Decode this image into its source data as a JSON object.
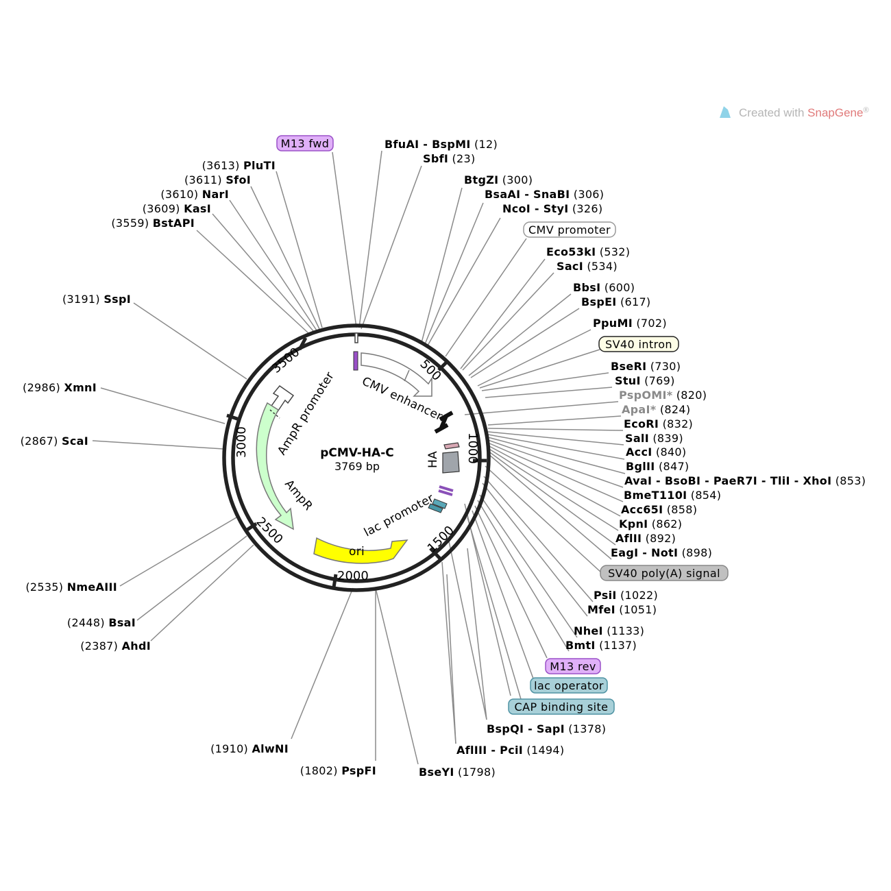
{
  "watermark": {
    "prefix": "Created with ",
    "brand": "SnapGene",
    "suffix": "®",
    "brand_color": "#e05a5a",
    "icon": "snapgene-logo-icon"
  },
  "plasmid": {
    "name": "pCMV-HA-C",
    "length": "3769 bp"
  },
  "ticks": [
    "500",
    "1000",
    "1500",
    "2000",
    "2500",
    "3000",
    "3500"
  ],
  "features": [
    {
      "name": "CMV enhancer",
      "color": "#ffffff"
    },
    {
      "name": "AmpR promoter",
      "color": "#ffffff"
    },
    {
      "name": "AmpR",
      "color": "#ccffcc"
    },
    {
      "name": "ori",
      "color": "#ffff00"
    },
    {
      "name": "lac promoter",
      "color": "#ffffff"
    },
    {
      "name": "HA",
      "color": "#a0a5ab"
    }
  ],
  "labeled_features": [
    {
      "name": "M13 fwd",
      "color": "#e0b0f8"
    },
    {
      "name": "CMV promoter",
      "color": "#ffffff"
    },
    {
      "name": "SV40 intron",
      "color": "#fdfde6"
    },
    {
      "name": "SV40 poly(A) signal",
      "color": "#c0c0c0"
    },
    {
      "name": "M13 rev",
      "color": "#e0b0f8"
    },
    {
      "name": "lac operator",
      "color": "#a8d0d8"
    },
    {
      "name": "CAP binding site",
      "color": "#a8d0d8"
    }
  ],
  "sites_right": [
    {
      "name": "BfuAI - BspMI",
      "pos": "(12)"
    },
    {
      "name": "SbfI",
      "pos": "(23)"
    },
    {
      "name": "BtgZI",
      "pos": "(300)"
    },
    {
      "name": "BsaAI - SnaBI",
      "pos": "(306)"
    },
    {
      "name": "NcoI - StyI",
      "pos": "(326)"
    },
    {
      "name": "Eco53kI",
      "pos": "(532)"
    },
    {
      "name": "SacI",
      "pos": "(534)"
    },
    {
      "name": "BbsI",
      "pos": "(600)"
    },
    {
      "name": "BspEI",
      "pos": "(617)"
    },
    {
      "name": "PpuMI",
      "pos": "(702)"
    },
    {
      "name": "BseRI",
      "pos": "(730)"
    },
    {
      "name": "StuI",
      "pos": "(769)"
    },
    {
      "name": "PspOMI*",
      "pos": "(820)"
    },
    {
      "name": "ApaI*",
      "pos": "(824)"
    },
    {
      "name": "EcoRI",
      "pos": "(832)"
    },
    {
      "name": "SalI",
      "pos": "(839)"
    },
    {
      "name": "AccI",
      "pos": "(840)"
    },
    {
      "name": "BglII",
      "pos": "(847)"
    },
    {
      "name": "AvaI - BsoBI - PaeR7I - TliI - XhoI",
      "pos": "(853)"
    },
    {
      "name": "BmeT110I",
      "pos": "(854)"
    },
    {
      "name": "Acc65I",
      "pos": "(858)"
    },
    {
      "name": "KpnI",
      "pos": "(862)"
    },
    {
      "name": "AflII",
      "pos": "(892)"
    },
    {
      "name": "EagI - NotI",
      "pos": "(898)"
    },
    {
      "name": "PsiI",
      "pos": "(1022)"
    },
    {
      "name": "MfeI",
      "pos": "(1051)"
    },
    {
      "name": "NheI",
      "pos": "(1133)"
    },
    {
      "name": "BmtI",
      "pos": "(1137)"
    },
    {
      "name": "BspQI - SapI",
      "pos": "(1378)"
    },
    {
      "name": "AflIII - PciI",
      "pos": "(1494)"
    },
    {
      "name": "BseYI",
      "pos": "(1798)"
    }
  ],
  "sites_left": [
    {
      "name": "PluTI",
      "pos": "(3613)"
    },
    {
      "name": "SfoI",
      "pos": "(3611)"
    },
    {
      "name": "NarI",
      "pos": "(3610)"
    },
    {
      "name": "KasI",
      "pos": "(3609)"
    },
    {
      "name": "BstAPI",
      "pos": "(3559)"
    },
    {
      "name": "SspI",
      "pos": "(3191)"
    },
    {
      "name": "XmnI",
      "pos": "(2986)"
    },
    {
      "name": "ScaI",
      "pos": "(2867)"
    },
    {
      "name": "NmeAIII",
      "pos": "(2535)"
    },
    {
      "name": "BsaI",
      "pos": "(2448)"
    },
    {
      "name": "AhdI",
      "pos": "(2387)"
    },
    {
      "name": "AlwNI",
      "pos": "(1910)"
    },
    {
      "name": "PspFI",
      "pos": "(1802)"
    }
  ]
}
